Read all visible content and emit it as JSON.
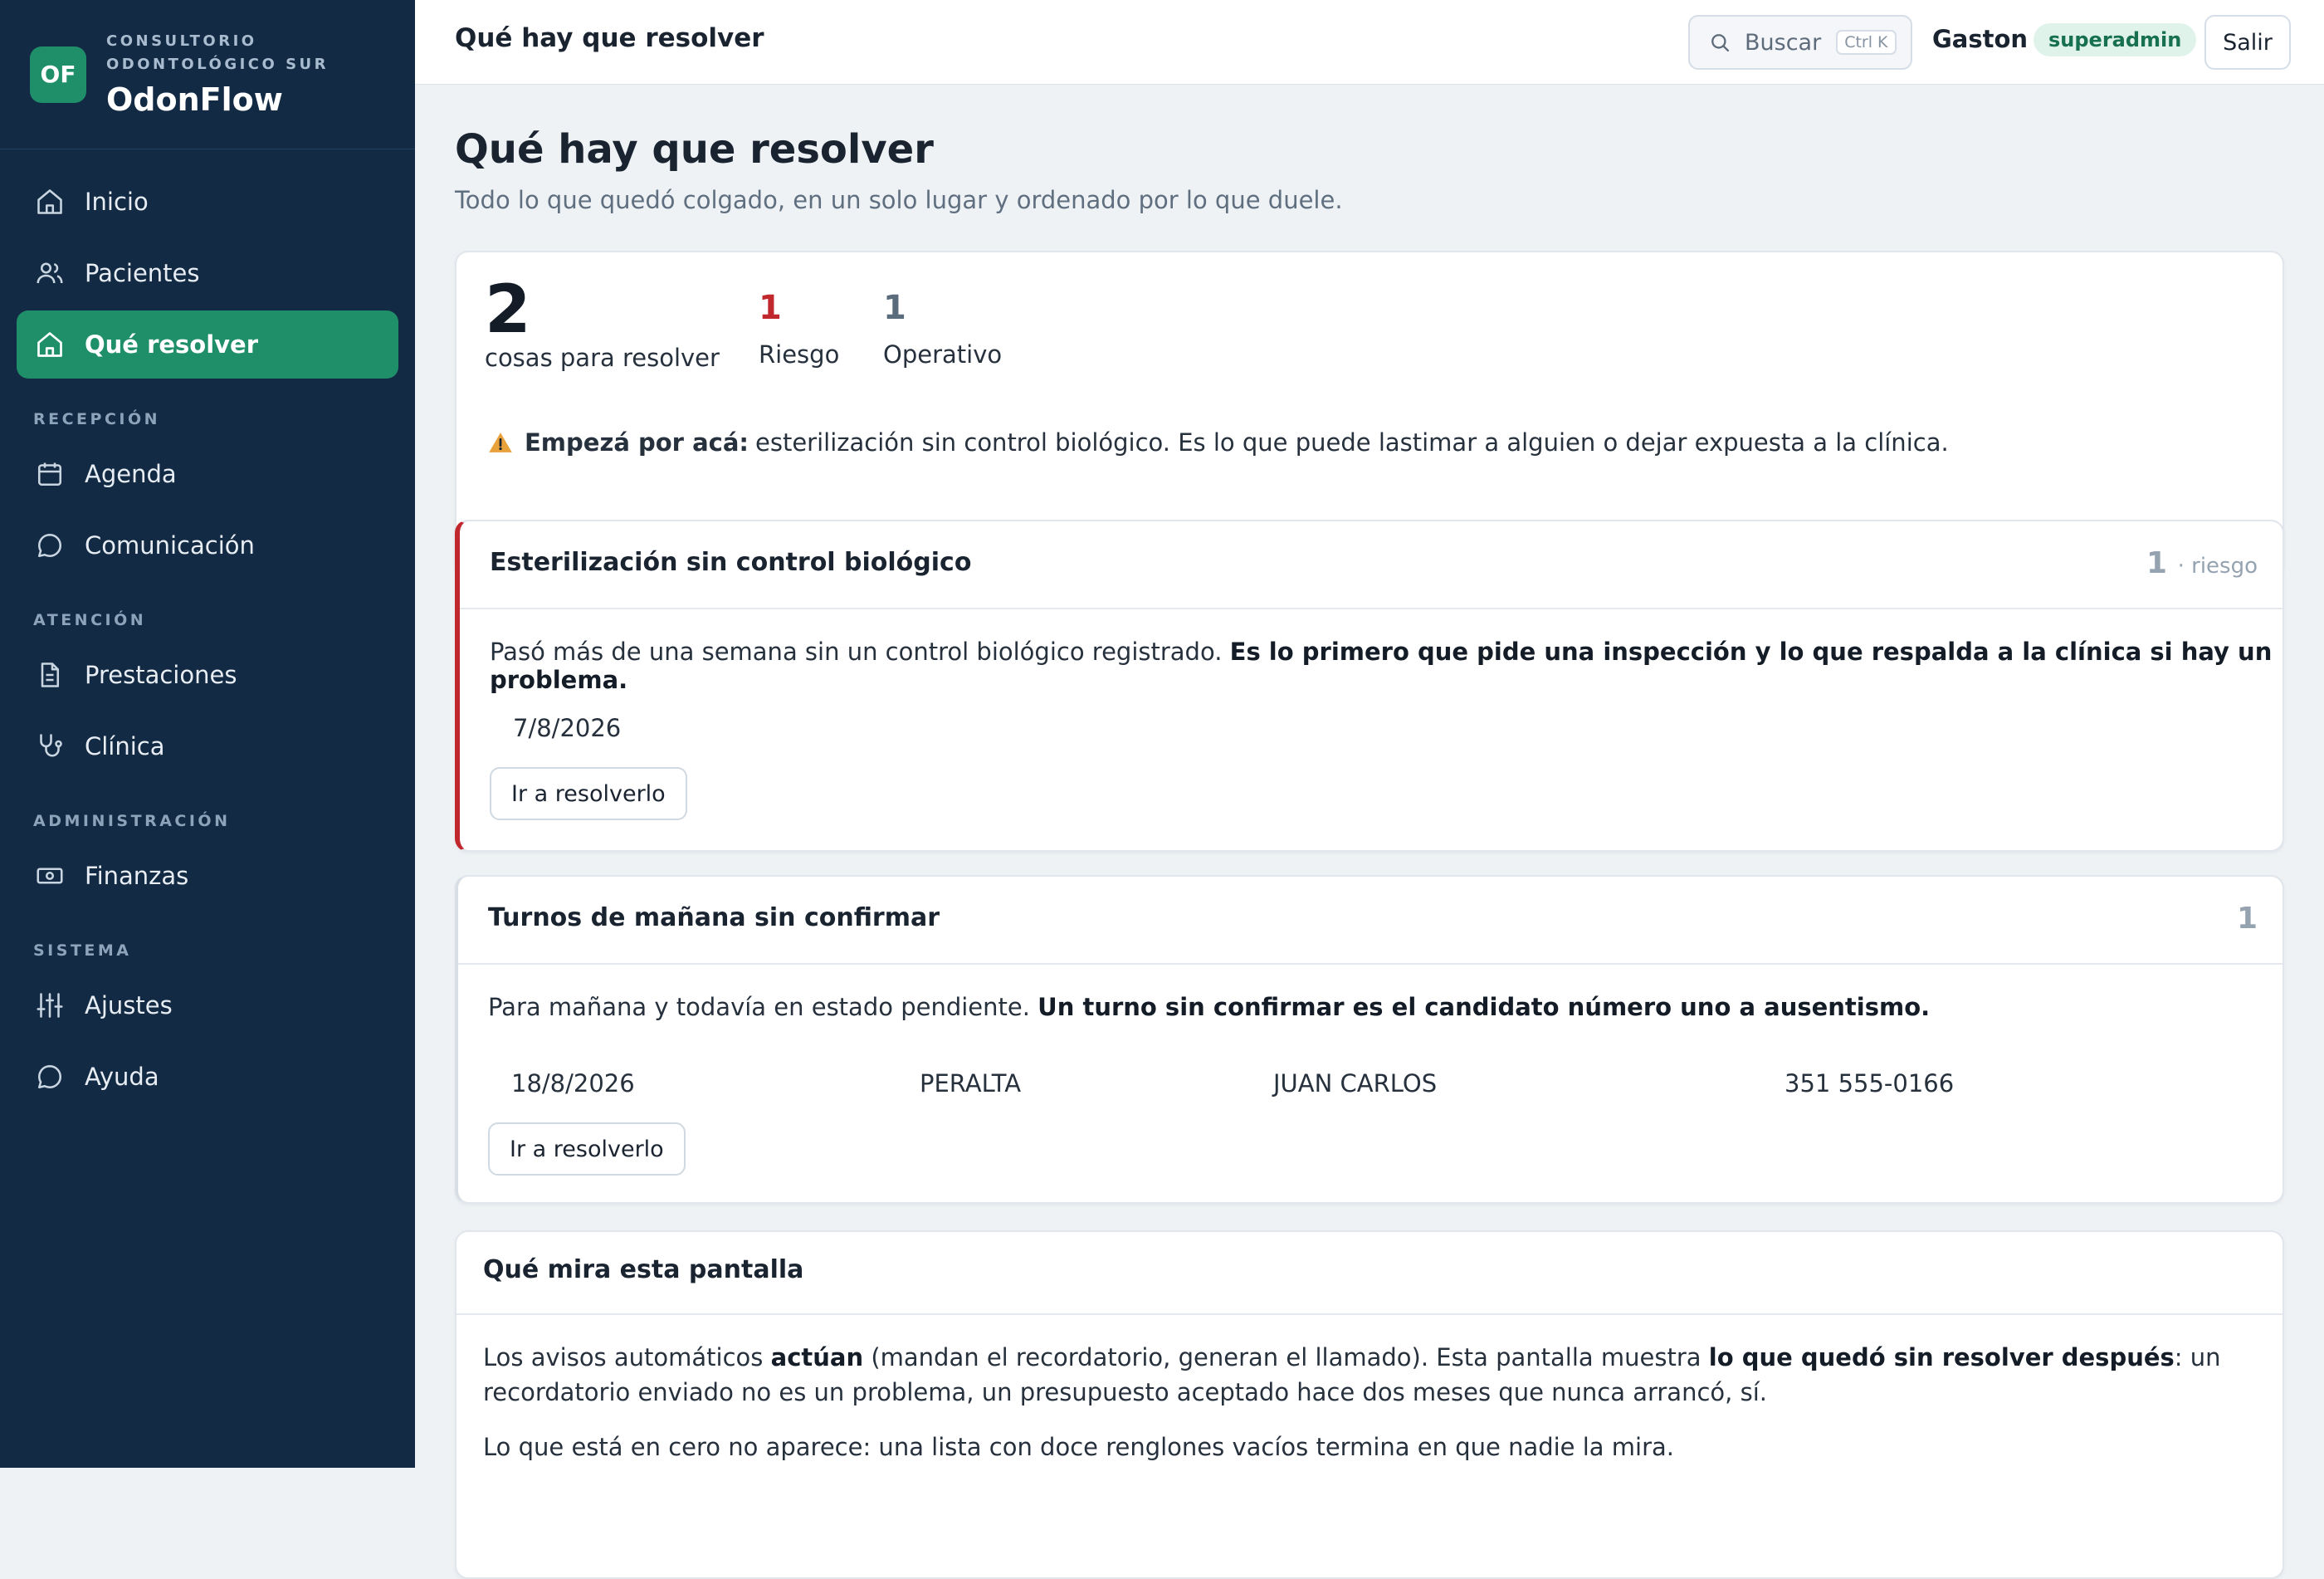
{
  "brand": {
    "logo": "OF",
    "sub1": "CONSULTORIO",
    "sub2": "ODONTOLÓGICO SUR",
    "name": "OdonFlow"
  },
  "nav": {
    "inicio": "Inicio",
    "pacientes": "Pacientes",
    "resolver": "Qué resolver",
    "sec_recepcion": "RECEPCIÓN",
    "agenda": "Agenda",
    "comunicacion": "Comunicación",
    "sec_atencion": "ATENCIÓN",
    "prestaciones": "Prestaciones",
    "clinica": "Clínica",
    "sec_admin": "ADMINISTRACIÓN",
    "finanzas": "Finanzas",
    "sec_sistema": "SISTEMA",
    "ajustes": "Ajustes",
    "ayuda": "Ayuda"
  },
  "topbar": {
    "title": "Qué hay que resolver",
    "search_label": "Buscar",
    "search_shortcut": "Ctrl K",
    "user": "Gaston",
    "role": "superadmin",
    "logout": "Salir"
  },
  "page": {
    "title": "Qué hay que resolver",
    "subtitle": "Todo lo que quedó colgado, en un solo lugar y ordenado por lo que duele."
  },
  "summary": {
    "total": "2",
    "total_label": "cosas para resolver",
    "risk_count": "1",
    "risk_label": "Riesgo",
    "ops_count": "1",
    "ops_label": "Operativo",
    "hint_strong": "Empezá por acá:",
    "hint_text": "esterilización sin control biológico. Es lo que puede lastimar a alguien o dejar expuesta a la clínica."
  },
  "issues": [
    {
      "title": "Esterilización sin control biológico",
      "count": "1",
      "count_label": "· riesgo",
      "desc": "Pasó más de una semana sin un control biológico registrado.",
      "desc_strong": "Es lo primero que pide una inspección y lo que respalda a la clínica si hay un problema.",
      "date": "7/8/2026",
      "action": "Ir a resolverlo"
    },
    {
      "title": "Turnos de mañana sin confirmar",
      "count": "1",
      "desc": "Para mañana y todavía en estado pendiente.",
      "desc_strong": "Un turno sin confirmar es el candidato número uno a ausentismo.",
      "date": "18/8/2026",
      "last_name": "PERALTA",
      "first_name": "JUAN CARLOS",
      "phone": "351 555-0166",
      "action": "Ir a resolverlo"
    }
  ],
  "info": {
    "title": "Qué mira esta pantalla",
    "p1_a": "Los avisos automáticos ",
    "p1_b": "actúan",
    "p1_c": " (mandan el recordatorio, generan el llamado). Esta pantalla muestra ",
    "p1_d": "lo que quedó sin resolver después",
    "p1_e": ": un recordatorio enviado no es un problema, un presupuesto aceptado hace dos meses que nunca arrancó, sí.",
    "p2": "Lo que está en cero no aparece: una lista con doce renglones vacíos termina en que nadie la mira."
  },
  "colors": {
    "sidebar": "#132a44",
    "accent": "#1f8f6a",
    "risk": "#c0282d",
    "ops": "#5a6b7c"
  }
}
